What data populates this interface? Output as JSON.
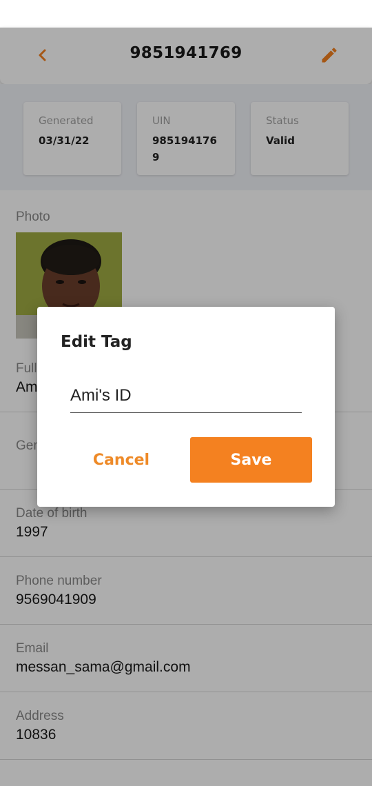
{
  "header": {
    "title": "9851941769",
    "back_icon": "chevron-left-icon",
    "edit_icon": "pencil-icon",
    "accent_color": "#f48120"
  },
  "summary": {
    "cards": [
      {
        "label": "Generated",
        "value": "03/31/22"
      },
      {
        "label": "UIN",
        "value": "9851941769"
      },
      {
        "label": "Status",
        "value": "Valid"
      }
    ]
  },
  "photo": {
    "label": "Photo"
  },
  "fields": [
    {
      "label": "Full Name",
      "value": "Ami"
    },
    {
      "label": "Gender",
      "value": ""
    },
    {
      "label": "Date of birth",
      "value": "1997"
    },
    {
      "label": "Phone number",
      "value": "9569041909"
    },
    {
      "label": "Email",
      "value": "messan_sama@gmail.com"
    },
    {
      "label": "Address",
      "value": "10836"
    }
  ],
  "dialog": {
    "title": "Edit Tag",
    "input_value": "Ami's ID",
    "cancel_label": "Cancel",
    "save_label": "Save"
  }
}
